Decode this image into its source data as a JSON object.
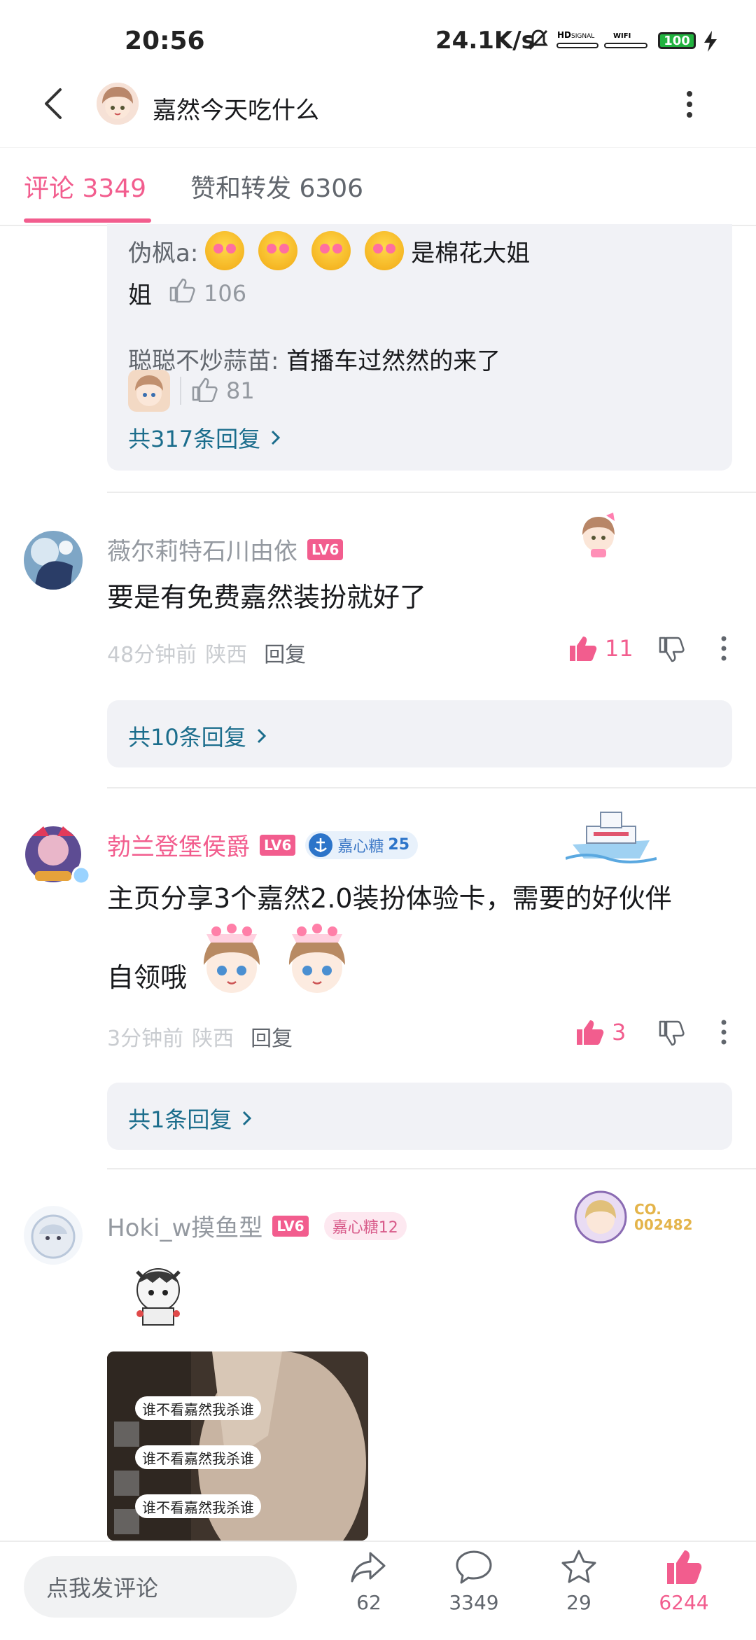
{
  "status": {
    "time": "20:56",
    "netspeed": "24.1K/s",
    "battery": "100"
  },
  "header": {
    "title": "嘉然今天吃什么"
  },
  "tabs": [
    {
      "label": "评论 3349"
    },
    {
      "label": "赞和转发 6306"
    }
  ],
  "prev_replies": {
    "r1_name": "伪枫a:",
    "r1_text_a": "是棉花大姐",
    "r1_text_b": "姐",
    "r1_likes": "106",
    "r2_name": "聪聪不炒蒜苗:",
    "r2_text": "首播车过然然的来了",
    "r2_likes": "81",
    "more": "共317条回复"
  },
  "comments": [
    {
      "user": "薇尔莉特石川由依",
      "level": "LV6",
      "text": "要是有免费嘉然装扮就好了",
      "time": "48分钟前",
      "location": "陕西",
      "reply": "回复",
      "likes": "11",
      "more": "共10条回复"
    },
    {
      "user": "勃兰登堡侯爵",
      "level": "LV6",
      "badge": "嘉心糖",
      "badge_level": "25",
      "text_a": "主页分享3个嘉然2.0装扮体验卡，需要的好伙伴",
      "text_b": "自领哦",
      "time": "3分钟前",
      "location": "陕西",
      "reply": "回复",
      "likes": "3",
      "more": "共1条回复"
    },
    {
      "user": "Hoki_w摸鱼型",
      "level": "LV6",
      "badge": "嘉心糖12",
      "card_no": "CO.\n002482",
      "pic_chips": [
        "谁不看嘉然我杀谁",
        "谁不看嘉然我杀谁",
        "谁不看嘉然我杀谁"
      ]
    }
  ],
  "bottom": {
    "placeholder": "点我发评论",
    "share": "62",
    "comment": "3349",
    "fav": "29",
    "like": "6244"
  },
  "colors": {
    "accent": "#f25d8e",
    "link": "#1b6d8c",
    "bg_box": "#f1f2f6"
  }
}
